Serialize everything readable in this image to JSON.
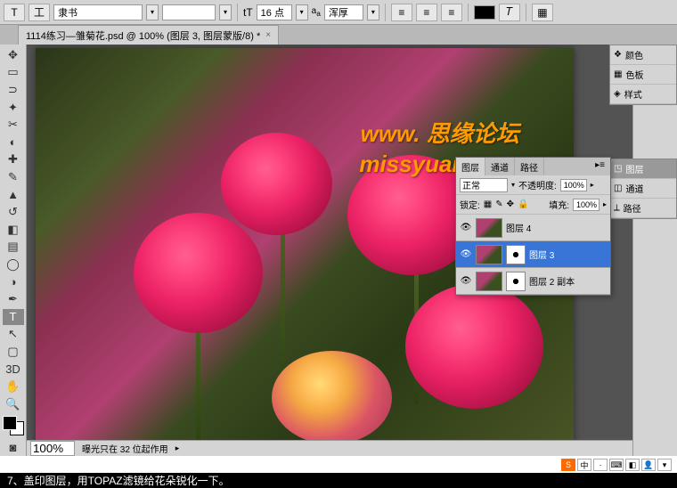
{
  "options_bar": {
    "font_family": "隶书",
    "font_size": "16 点",
    "anti_alias": "浑厚"
  },
  "document": {
    "title": "1114练习—雏菊花.psd @ 100% (图层 3, 图层蒙版/8) *"
  },
  "watermark": {
    "line1": "www.  思缘论坛",
    "line2": "missyuan.com"
  },
  "right_panels": {
    "color": "颜色",
    "swatches": "色板",
    "styles": "样式",
    "layers": "图层",
    "channels": "通道",
    "paths": "路径"
  },
  "layers_panel": {
    "tabs": [
      "图层",
      "通道",
      "路径"
    ],
    "blend_mode": "正常",
    "opacity_label": "不透明度:",
    "opacity_value": "100%",
    "lock_label": "锁定:",
    "fill_label": "填充:",
    "fill_value": "100%",
    "layers": [
      {
        "name": "图层 4",
        "visible": true,
        "selected": false
      },
      {
        "name": "图层 3",
        "visible": true,
        "selected": true
      },
      {
        "name": "图层 2 副本",
        "visible": true,
        "selected": false
      }
    ]
  },
  "statusbar": {
    "zoom": "100%",
    "info": "曝光只在 32 位起作用"
  },
  "caption": "7、盖印图层，用TOPAZ滤镜给花朵锐化一下。",
  "ime_bar": {
    "label": "中"
  }
}
